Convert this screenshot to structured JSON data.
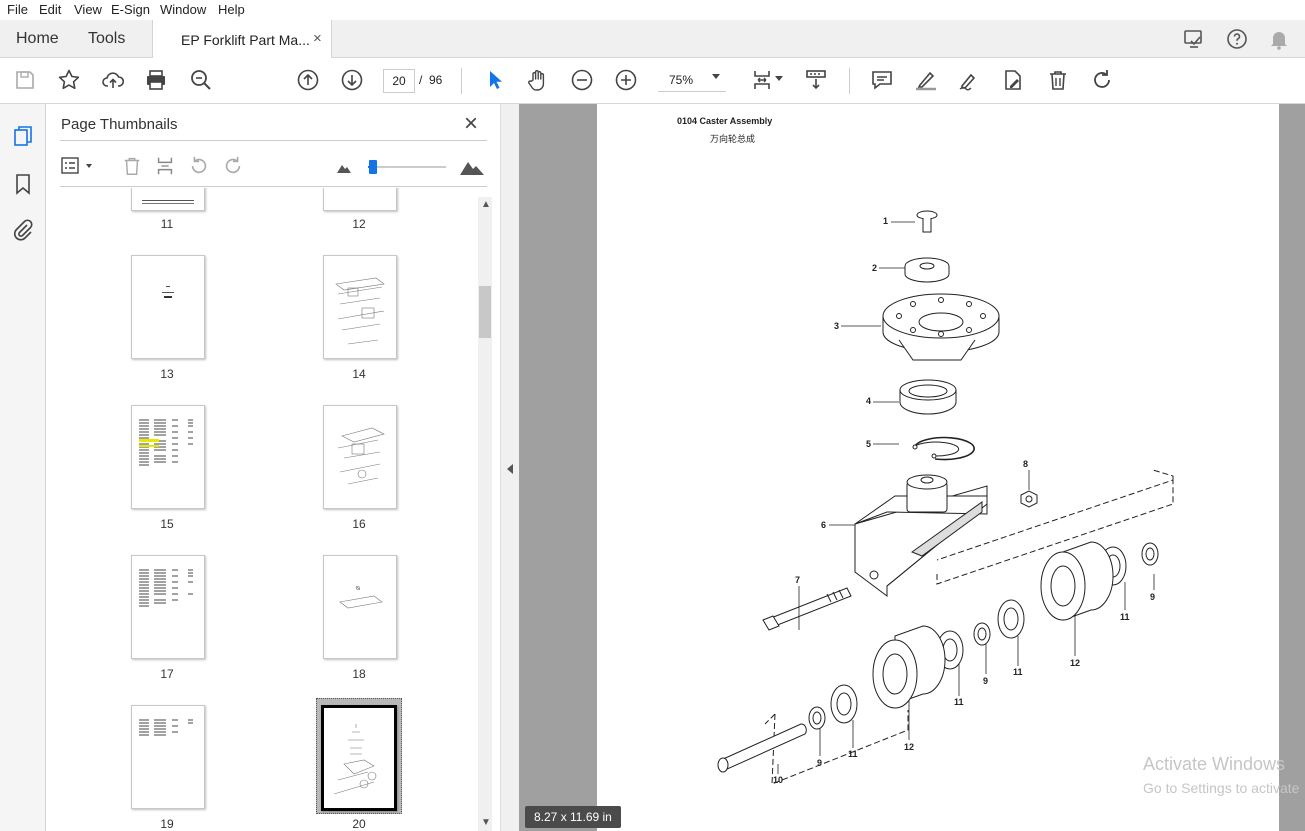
{
  "menu": [
    "File",
    "Edit",
    "View",
    "E-Sign",
    "Window",
    "Help"
  ],
  "tabs": {
    "home": "Home",
    "tools": "Tools",
    "document": "EP Forklift Part Ma...",
    "close": "×"
  },
  "toolbar": {
    "page_current": "20",
    "page_sep": "/",
    "page_total": "96",
    "zoom": "75%"
  },
  "panel": {
    "title": "Page Thumbnails",
    "close": "×",
    "zoom_slider_value": 0.07,
    "thumbnails": [
      {
        "label": "11"
      },
      {
        "label": "12"
      },
      {
        "label": "13"
      },
      {
        "label": "14"
      },
      {
        "label": "15"
      },
      {
        "label": "16"
      },
      {
        "label": "17"
      },
      {
        "label": "18"
      },
      {
        "label": "19"
      },
      {
        "label": "20",
        "selected": true
      }
    ]
  },
  "document": {
    "heading": "0104 Caster Assembly",
    "subheading": "万向轮总成",
    "callouts": {
      "c1": "1",
      "c2": "2",
      "c3": "3",
      "c4": "4",
      "c5": "5",
      "c6": "6",
      "c7": "7",
      "c8": "8",
      "c9a": "9",
      "c9b": "9",
      "c9c": "9",
      "c10": "10",
      "c11a": "11",
      "c11b": "11",
      "c11c": "11",
      "c11d": "11",
      "c12a": "12",
      "c12b": "12"
    },
    "page_size": "8.27 x 11.69 in"
  },
  "watermark": {
    "line1": "Activate Windows",
    "line2": "Go to Settings to activate"
  },
  "colors": {
    "accent": "#1473e6",
    "viewer_bg": "#a0a0a0",
    "selected_thumb": "#000000"
  }
}
